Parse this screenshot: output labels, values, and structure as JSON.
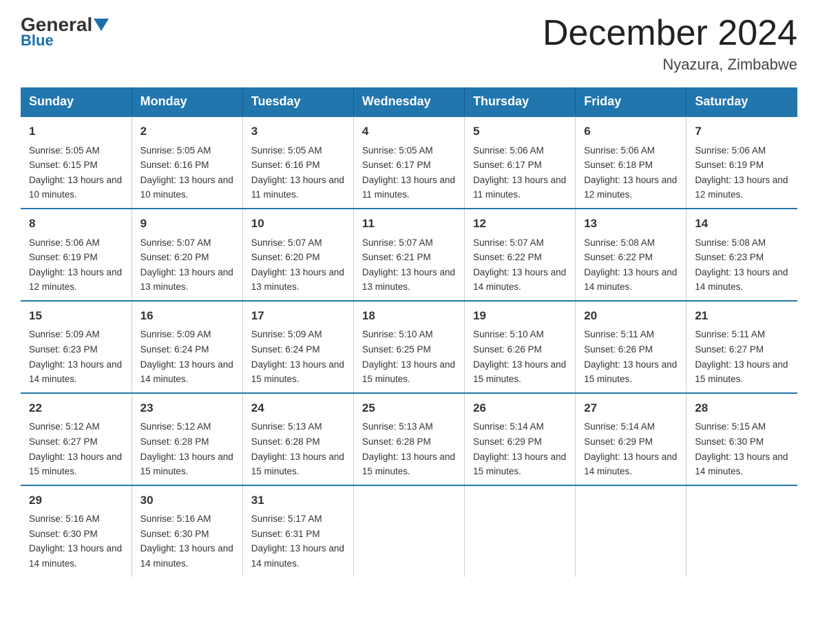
{
  "logo": {
    "general": "General",
    "blue": "Blue"
  },
  "title": "December 2024",
  "location": "Nyazura, Zimbabwe",
  "days_header": [
    "Sunday",
    "Monday",
    "Tuesday",
    "Wednesday",
    "Thursday",
    "Friday",
    "Saturday"
  ],
  "weeks": [
    [
      {
        "day": "1",
        "sunrise": "5:05 AM",
        "sunset": "6:15 PM",
        "daylight": "13 hours and 10 minutes."
      },
      {
        "day": "2",
        "sunrise": "5:05 AM",
        "sunset": "6:16 PM",
        "daylight": "13 hours and 10 minutes."
      },
      {
        "day": "3",
        "sunrise": "5:05 AM",
        "sunset": "6:16 PM",
        "daylight": "13 hours and 11 minutes."
      },
      {
        "day": "4",
        "sunrise": "5:05 AM",
        "sunset": "6:17 PM",
        "daylight": "13 hours and 11 minutes."
      },
      {
        "day": "5",
        "sunrise": "5:06 AM",
        "sunset": "6:17 PM",
        "daylight": "13 hours and 11 minutes."
      },
      {
        "day": "6",
        "sunrise": "5:06 AM",
        "sunset": "6:18 PM",
        "daylight": "13 hours and 12 minutes."
      },
      {
        "day": "7",
        "sunrise": "5:06 AM",
        "sunset": "6:19 PM",
        "daylight": "13 hours and 12 minutes."
      }
    ],
    [
      {
        "day": "8",
        "sunrise": "5:06 AM",
        "sunset": "6:19 PM",
        "daylight": "13 hours and 12 minutes."
      },
      {
        "day": "9",
        "sunrise": "5:07 AM",
        "sunset": "6:20 PM",
        "daylight": "13 hours and 13 minutes."
      },
      {
        "day": "10",
        "sunrise": "5:07 AM",
        "sunset": "6:20 PM",
        "daylight": "13 hours and 13 minutes."
      },
      {
        "day": "11",
        "sunrise": "5:07 AM",
        "sunset": "6:21 PM",
        "daylight": "13 hours and 13 minutes."
      },
      {
        "day": "12",
        "sunrise": "5:07 AM",
        "sunset": "6:22 PM",
        "daylight": "13 hours and 14 minutes."
      },
      {
        "day": "13",
        "sunrise": "5:08 AM",
        "sunset": "6:22 PM",
        "daylight": "13 hours and 14 minutes."
      },
      {
        "day": "14",
        "sunrise": "5:08 AM",
        "sunset": "6:23 PM",
        "daylight": "13 hours and 14 minutes."
      }
    ],
    [
      {
        "day": "15",
        "sunrise": "5:09 AM",
        "sunset": "6:23 PM",
        "daylight": "13 hours and 14 minutes."
      },
      {
        "day": "16",
        "sunrise": "5:09 AM",
        "sunset": "6:24 PM",
        "daylight": "13 hours and 14 minutes."
      },
      {
        "day": "17",
        "sunrise": "5:09 AM",
        "sunset": "6:24 PM",
        "daylight": "13 hours and 15 minutes."
      },
      {
        "day": "18",
        "sunrise": "5:10 AM",
        "sunset": "6:25 PM",
        "daylight": "13 hours and 15 minutes."
      },
      {
        "day": "19",
        "sunrise": "5:10 AM",
        "sunset": "6:26 PM",
        "daylight": "13 hours and 15 minutes."
      },
      {
        "day": "20",
        "sunrise": "5:11 AM",
        "sunset": "6:26 PM",
        "daylight": "13 hours and 15 minutes."
      },
      {
        "day": "21",
        "sunrise": "5:11 AM",
        "sunset": "6:27 PM",
        "daylight": "13 hours and 15 minutes."
      }
    ],
    [
      {
        "day": "22",
        "sunrise": "5:12 AM",
        "sunset": "6:27 PM",
        "daylight": "13 hours and 15 minutes."
      },
      {
        "day": "23",
        "sunrise": "5:12 AM",
        "sunset": "6:28 PM",
        "daylight": "13 hours and 15 minutes."
      },
      {
        "day": "24",
        "sunrise": "5:13 AM",
        "sunset": "6:28 PM",
        "daylight": "13 hours and 15 minutes."
      },
      {
        "day": "25",
        "sunrise": "5:13 AM",
        "sunset": "6:28 PM",
        "daylight": "13 hours and 15 minutes."
      },
      {
        "day": "26",
        "sunrise": "5:14 AM",
        "sunset": "6:29 PM",
        "daylight": "13 hours and 15 minutes."
      },
      {
        "day": "27",
        "sunrise": "5:14 AM",
        "sunset": "6:29 PM",
        "daylight": "13 hours and 14 minutes."
      },
      {
        "day": "28",
        "sunrise": "5:15 AM",
        "sunset": "6:30 PM",
        "daylight": "13 hours and 14 minutes."
      }
    ],
    [
      {
        "day": "29",
        "sunrise": "5:16 AM",
        "sunset": "6:30 PM",
        "daylight": "13 hours and 14 minutes."
      },
      {
        "day": "30",
        "sunrise": "5:16 AM",
        "sunset": "6:30 PM",
        "daylight": "13 hours and 14 minutes."
      },
      {
        "day": "31",
        "sunrise": "5:17 AM",
        "sunset": "6:31 PM",
        "daylight": "13 hours and 14 minutes."
      },
      {
        "day": "",
        "sunrise": "",
        "sunset": "",
        "daylight": ""
      },
      {
        "day": "",
        "sunrise": "",
        "sunset": "",
        "daylight": ""
      },
      {
        "day": "",
        "sunrise": "",
        "sunset": "",
        "daylight": ""
      },
      {
        "day": "",
        "sunrise": "",
        "sunset": "",
        "daylight": ""
      }
    ]
  ]
}
